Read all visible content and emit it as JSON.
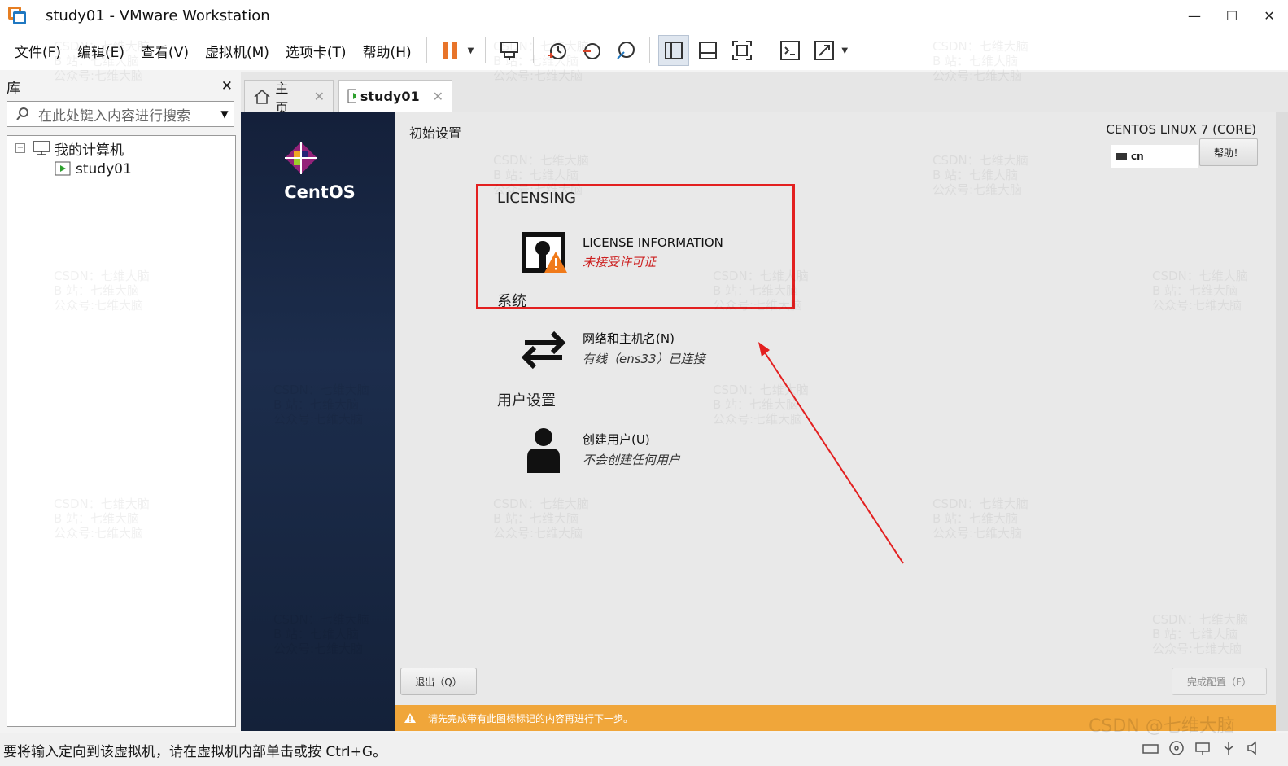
{
  "window": {
    "title": "study01 - VMware Workstation",
    "controls": [
      "—",
      "☐",
      "✕"
    ]
  },
  "menu": [
    "文件(F)",
    "编辑(E)",
    "查看(V)",
    "虚拟机(M)",
    "选项卡(T)",
    "帮助(H)"
  ],
  "library": {
    "title": "库",
    "search_placeholder": "在此处键入内容进行搜索",
    "tree_root": "我的计算机",
    "tree_child": "study01"
  },
  "tabs": [
    {
      "label": "主页"
    },
    {
      "label": "study01"
    }
  ],
  "guest": {
    "logo_text": "CentOS",
    "screen_title": "初始设置",
    "os_name": "CENTOS LINUX 7 (CORE)",
    "keyboard": "cn",
    "help_label": "帮助！",
    "sections": {
      "licensing": "LICENSING",
      "system": "系统",
      "user": "用户设置"
    },
    "spokes": {
      "license": {
        "title": "LICENSE INFORMATION",
        "status": "未接受许可证"
      },
      "network": {
        "title": "网络和主机名(N)",
        "status": "有线（ens33）已连接"
      },
      "user": {
        "title": "创建用户(U)",
        "status": "不会创建任何用户"
      }
    },
    "quit_label": "退出（Q）",
    "finish_label": "完成配置（F）",
    "warning_text": "请先完成带有此图标标记的内容再进行下一步。"
  },
  "statusbar": {
    "text": "要将输入定向到该虚拟机，请在虚拟机内部单击或按 Ctrl+G。"
  },
  "watermark": {
    "line1": "CSDN：七维大脑",
    "line2": "B 站：七维大脑",
    "line3": "公众号:七维大脑",
    "corner": "CSDN @七维大脑"
  },
  "colors": {
    "accent_red": "#e32020",
    "warning_bar": "#f0a63a",
    "sidebar_dark": "#1c2d4c"
  }
}
